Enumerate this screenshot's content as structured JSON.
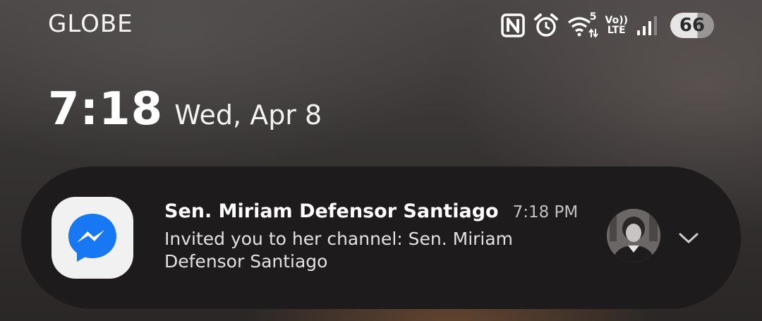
{
  "status_bar": {
    "carrier": "GLOBE",
    "icons": [
      "nfc-icon",
      "alarm-icon",
      "wifi-icon",
      "volte-lte-icon",
      "signal-icon"
    ],
    "wifi_badge": "5",
    "volte_top": "Vo))",
    "volte_bottom": "LTE",
    "battery_level": "66",
    "battery_fraction": 0.66
  },
  "lock_clock": {
    "time": "7:18",
    "date": "Wed, Apr 8"
  },
  "notification": {
    "app_icon": "messenger-icon",
    "sender": "Sen. Miriam Defensor Santiago",
    "time": "7:18 PM",
    "message": "Invited you to her channel: Sen. Miriam Defensor Santiago",
    "expand_icon": "chevron-down-icon"
  },
  "colors": {
    "messenger_blue": "#1877f2",
    "notification_bg": "#1d1b1b"
  }
}
